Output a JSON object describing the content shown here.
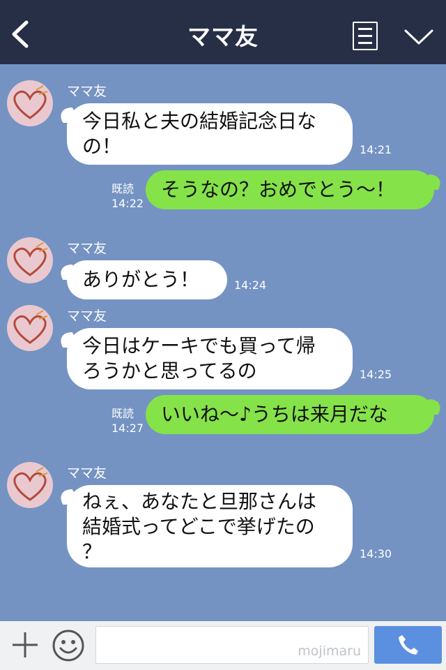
{
  "header": {
    "title": "ママ友"
  },
  "messages": [
    {
      "sender": "ママ友",
      "lines": [
        "今日私と夫の結婚記念日な",
        "の！"
      ],
      "time": "14:21"
    },
    {
      "read": "既読",
      "time": "14:22",
      "text": "そうなの？おめでとう〜！"
    },
    {
      "sender": "ママ友",
      "lines": [
        "ありがとう！"
      ],
      "time": "14:24"
    },
    {
      "sender": "ママ友",
      "lines": [
        "今日はケーキでも買って帰",
        "ろうかと思ってるの"
      ],
      "time": "14:25"
    },
    {
      "read": "既読",
      "time": "14:27",
      "text": "いいね〜♪うちは来月だな"
    },
    {
      "sender": "ママ友",
      "lines": [
        "ねぇ、あなたと旦那さんは",
        "結婚式ってどこで挙げたの",
        "？"
      ],
      "time": "14:30"
    }
  ],
  "footer": {
    "input_value": "",
    "watermark": "mojimaru"
  },
  "icons": {
    "back": "chevron-left-icon",
    "menu": "note-icon",
    "expand": "chevron-down-icon",
    "add": "plus-icon",
    "emoji": "smiley-icon",
    "call": "phone-icon"
  },
  "colors": {
    "header": "#262f45",
    "background": "#7493c3",
    "sent_bubble": "#85e249",
    "call_button": "#5b8fe0"
  }
}
